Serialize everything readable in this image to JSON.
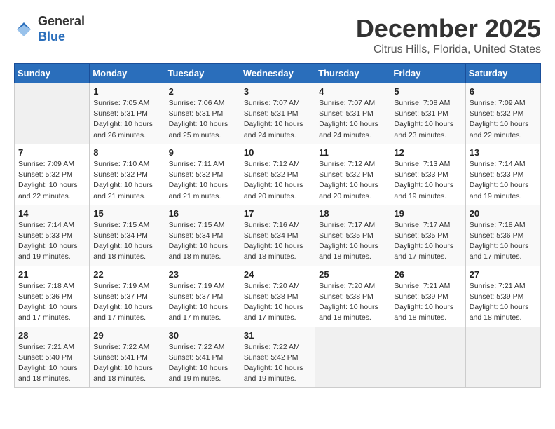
{
  "header": {
    "logo_line1": "General",
    "logo_line2": "Blue",
    "month_title": "December 2025",
    "location": "Citrus Hills, Florida, United States"
  },
  "days_of_week": [
    "Sunday",
    "Monday",
    "Tuesday",
    "Wednesday",
    "Thursday",
    "Friday",
    "Saturday"
  ],
  "weeks": [
    [
      {
        "day": "",
        "info": ""
      },
      {
        "day": "1",
        "info": "Sunrise: 7:05 AM\nSunset: 5:31 PM\nDaylight: 10 hours\nand 26 minutes."
      },
      {
        "day": "2",
        "info": "Sunrise: 7:06 AM\nSunset: 5:31 PM\nDaylight: 10 hours\nand 25 minutes."
      },
      {
        "day": "3",
        "info": "Sunrise: 7:07 AM\nSunset: 5:31 PM\nDaylight: 10 hours\nand 24 minutes."
      },
      {
        "day": "4",
        "info": "Sunrise: 7:07 AM\nSunset: 5:31 PM\nDaylight: 10 hours\nand 24 minutes."
      },
      {
        "day": "5",
        "info": "Sunrise: 7:08 AM\nSunset: 5:31 PM\nDaylight: 10 hours\nand 23 minutes."
      },
      {
        "day": "6",
        "info": "Sunrise: 7:09 AM\nSunset: 5:32 PM\nDaylight: 10 hours\nand 22 minutes."
      }
    ],
    [
      {
        "day": "7",
        "info": "Sunrise: 7:09 AM\nSunset: 5:32 PM\nDaylight: 10 hours\nand 22 minutes."
      },
      {
        "day": "8",
        "info": "Sunrise: 7:10 AM\nSunset: 5:32 PM\nDaylight: 10 hours\nand 21 minutes."
      },
      {
        "day": "9",
        "info": "Sunrise: 7:11 AM\nSunset: 5:32 PM\nDaylight: 10 hours\nand 21 minutes."
      },
      {
        "day": "10",
        "info": "Sunrise: 7:12 AM\nSunset: 5:32 PM\nDaylight: 10 hours\nand 20 minutes."
      },
      {
        "day": "11",
        "info": "Sunrise: 7:12 AM\nSunset: 5:32 PM\nDaylight: 10 hours\nand 20 minutes."
      },
      {
        "day": "12",
        "info": "Sunrise: 7:13 AM\nSunset: 5:33 PM\nDaylight: 10 hours\nand 19 minutes."
      },
      {
        "day": "13",
        "info": "Sunrise: 7:14 AM\nSunset: 5:33 PM\nDaylight: 10 hours\nand 19 minutes."
      }
    ],
    [
      {
        "day": "14",
        "info": "Sunrise: 7:14 AM\nSunset: 5:33 PM\nDaylight: 10 hours\nand 19 minutes."
      },
      {
        "day": "15",
        "info": "Sunrise: 7:15 AM\nSunset: 5:34 PM\nDaylight: 10 hours\nand 18 minutes."
      },
      {
        "day": "16",
        "info": "Sunrise: 7:15 AM\nSunset: 5:34 PM\nDaylight: 10 hours\nand 18 minutes."
      },
      {
        "day": "17",
        "info": "Sunrise: 7:16 AM\nSunset: 5:34 PM\nDaylight: 10 hours\nand 18 minutes."
      },
      {
        "day": "18",
        "info": "Sunrise: 7:17 AM\nSunset: 5:35 PM\nDaylight: 10 hours\nand 18 minutes."
      },
      {
        "day": "19",
        "info": "Sunrise: 7:17 AM\nSunset: 5:35 PM\nDaylight: 10 hours\nand 17 minutes."
      },
      {
        "day": "20",
        "info": "Sunrise: 7:18 AM\nSunset: 5:36 PM\nDaylight: 10 hours\nand 17 minutes."
      }
    ],
    [
      {
        "day": "21",
        "info": "Sunrise: 7:18 AM\nSunset: 5:36 PM\nDaylight: 10 hours\nand 17 minutes."
      },
      {
        "day": "22",
        "info": "Sunrise: 7:19 AM\nSunset: 5:37 PM\nDaylight: 10 hours\nand 17 minutes."
      },
      {
        "day": "23",
        "info": "Sunrise: 7:19 AM\nSunset: 5:37 PM\nDaylight: 10 hours\nand 17 minutes."
      },
      {
        "day": "24",
        "info": "Sunrise: 7:20 AM\nSunset: 5:38 PM\nDaylight: 10 hours\nand 17 minutes."
      },
      {
        "day": "25",
        "info": "Sunrise: 7:20 AM\nSunset: 5:38 PM\nDaylight: 10 hours\nand 18 minutes."
      },
      {
        "day": "26",
        "info": "Sunrise: 7:21 AM\nSunset: 5:39 PM\nDaylight: 10 hours\nand 18 minutes."
      },
      {
        "day": "27",
        "info": "Sunrise: 7:21 AM\nSunset: 5:39 PM\nDaylight: 10 hours\nand 18 minutes."
      }
    ],
    [
      {
        "day": "28",
        "info": "Sunrise: 7:21 AM\nSunset: 5:40 PM\nDaylight: 10 hours\nand 18 minutes."
      },
      {
        "day": "29",
        "info": "Sunrise: 7:22 AM\nSunset: 5:41 PM\nDaylight: 10 hours\nand 18 minutes."
      },
      {
        "day": "30",
        "info": "Sunrise: 7:22 AM\nSunset: 5:41 PM\nDaylight: 10 hours\nand 19 minutes."
      },
      {
        "day": "31",
        "info": "Sunrise: 7:22 AM\nSunset: 5:42 PM\nDaylight: 10 hours\nand 19 minutes."
      },
      {
        "day": "",
        "info": ""
      },
      {
        "day": "",
        "info": ""
      },
      {
        "day": "",
        "info": ""
      }
    ]
  ]
}
